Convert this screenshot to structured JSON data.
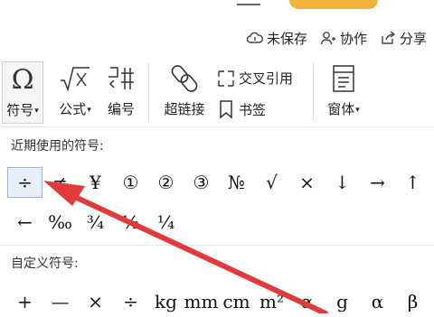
{
  "toolbar_actions": {
    "unsaved": "未保存",
    "collaborate": "协作",
    "share": "分享"
  },
  "ribbon": {
    "symbol": "符号",
    "formula": "公式",
    "numbering": "编号",
    "hyperlink": "超链接",
    "cross_ref": "交叉引用",
    "bookmark": "书签",
    "form": "窗体"
  },
  "recent": {
    "title": "近期使用的符号:",
    "row1": [
      "÷",
      "≠",
      "¥",
      "①",
      "②",
      "③",
      "№",
      "√",
      "×",
      "↓",
      "→",
      "↑"
    ],
    "row2": [
      "←",
      "‰",
      "¾",
      "½",
      "¼"
    ]
  },
  "custom": {
    "title": "自定义符号:",
    "row": [
      "+",
      "—",
      "×",
      "÷",
      "kg",
      "mm",
      "cm",
      "m²",
      "α",
      "g",
      "α",
      "β"
    ]
  },
  "colors": {
    "accent_orange": "#f3b33a",
    "arrow_red": "#e23a3a",
    "selected_bg": "#e8eef8"
  }
}
